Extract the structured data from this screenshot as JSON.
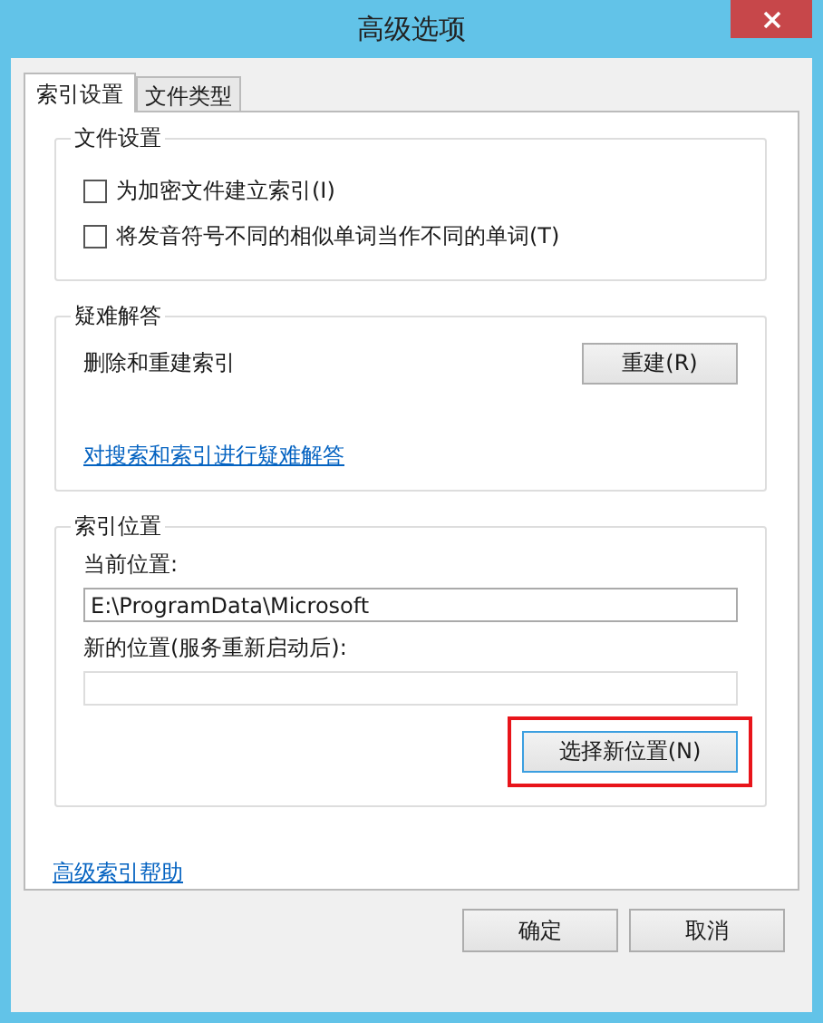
{
  "window": {
    "title": "高级选项"
  },
  "tabs": [
    {
      "label": "索引设置",
      "selected": true
    },
    {
      "label": "文件类型",
      "selected": false
    }
  ],
  "file_settings": {
    "title": "文件设置",
    "options": [
      {
        "label": "为加密文件建立索引(I)",
        "checked": false
      },
      {
        "label": "将发音符号不同的相似单词当作不同的单词(T)",
        "checked": false
      }
    ]
  },
  "troubleshooting": {
    "title": "疑难解答",
    "description": "删除和重建索引",
    "rebuild_button": "重建(R)",
    "link": "对搜索和索引进行疑难解答"
  },
  "index_location": {
    "title": "索引位置",
    "current_label": "当前位置:",
    "current_value": "E:\\ProgramData\\Microsoft",
    "new_label": "新的位置(服务重新启动后):",
    "select_button": {
      "label": "选择新位置(N)",
      "highlighted": true
    }
  },
  "help_link": "高级索引帮助",
  "buttons": [
    "确定",
    "取消"
  ]
}
